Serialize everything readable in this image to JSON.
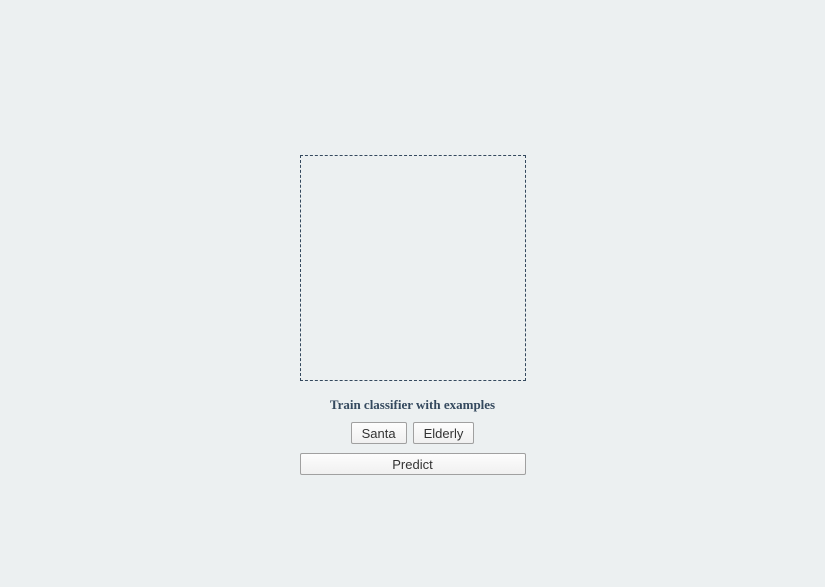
{
  "heading": "Train classifier with examples",
  "buttons": {
    "class_a": "Santa",
    "class_b": "Elderly",
    "predict": "Predict"
  }
}
